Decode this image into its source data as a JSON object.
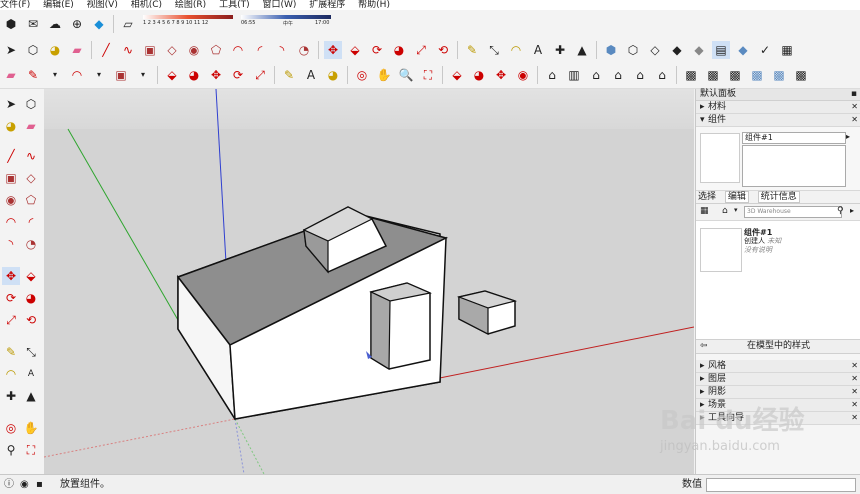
{
  "menu": [
    "文件(F)",
    "编辑(E)",
    "视图(V)",
    "相机(C)",
    "绘图(R)",
    "工具(T)",
    "窗口(W)",
    "扩展程序",
    "帮助(H)"
  ],
  "style_strip": {
    "ticks": "1 2 3 4 5 6 7 8 9 10 11 12",
    "time_left": "06:55",
    "time_mid": "中午",
    "time_right": "17:00"
  },
  "panel": {
    "title": "默认面板",
    "materials": "材料",
    "components": "组件",
    "component_name": "组件#1",
    "tabs": [
      "选择",
      "编辑",
      "统计信息"
    ],
    "search_placeholder": "3D Warehouse",
    "item_name": "组件#1",
    "item_creator": "创建人",
    "item_creator_value": "未知",
    "item_desc": "没有说明",
    "model_styles": "在模型中的样式",
    "sections": [
      "风格",
      "图层",
      "阴影",
      "场景",
      "工具向导"
    ]
  },
  "status": {
    "message": "放置组件。",
    "value_label": "数值"
  },
  "watermark": {
    "brand": "Bai du经验",
    "url": "jingyan.baidu.com"
  }
}
